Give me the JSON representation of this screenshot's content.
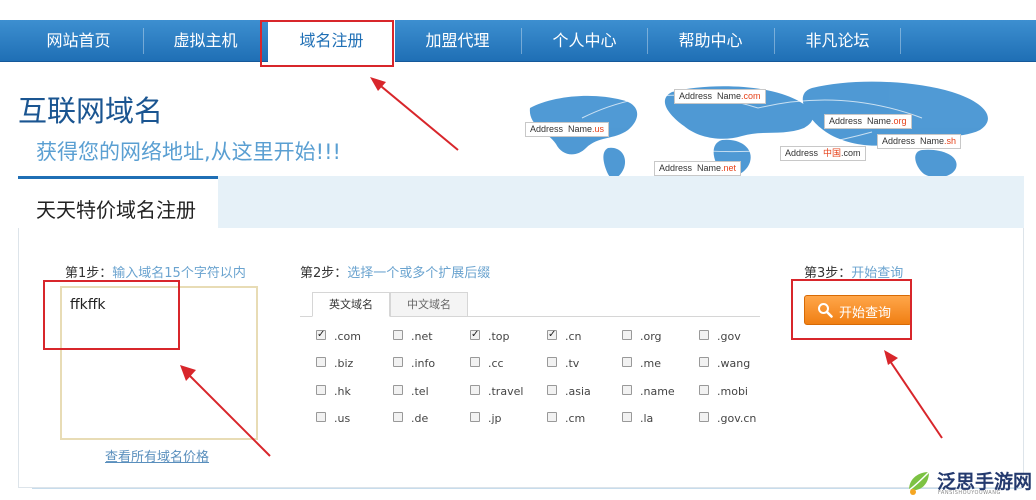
{
  "nav": {
    "items": [
      {
        "label": "网站首页"
      },
      {
        "label": "虚拟主机"
      },
      {
        "label": "域名注册",
        "active": true
      },
      {
        "label": "加盟代理"
      },
      {
        "label": "个人中心"
      },
      {
        "label": "帮助中心"
      },
      {
        "label": "非凡论坛"
      }
    ]
  },
  "header": {
    "title": "互联网域名",
    "subtitle": "获得您的网络地址,从这里开始!!!"
  },
  "map": {
    "tags": [
      {
        "word": "Address",
        "name": "Name",
        "tld": ".com"
      },
      {
        "word": "Address",
        "name": "Name",
        "tld": ".us"
      },
      {
        "word": "Address",
        "name": "Name",
        "tld": ".org"
      },
      {
        "word": "Address",
        "name": "Name",
        "tld": ".sh"
      },
      {
        "word": "Address",
        "cn": "中国",
        "tld": ".com"
      },
      {
        "word": "Address",
        "name": "Name",
        "tld": ".net"
      }
    ]
  },
  "panel": {
    "tab": "天天特价域名注册"
  },
  "step1": {
    "label": "第1步：",
    "hint": "输入域名15个字符以内",
    "value": "ffkffk",
    "price_link": "查看所有域名价格"
  },
  "step2": {
    "label": "第2步：",
    "hint": "选择一个或多个扩展后缀",
    "tabs": [
      "英文域名",
      "中文域名"
    ],
    "options": [
      {
        "label": ".com",
        "checked": true
      },
      {
        "label": ".net",
        "checked": false
      },
      {
        "label": ".top",
        "checked": true
      },
      {
        "label": ".cn",
        "checked": true
      },
      {
        "label": ".org",
        "checked": false
      },
      {
        "label": ".gov",
        "checked": false
      },
      {
        "label": ".biz",
        "checked": false
      },
      {
        "label": ".info",
        "checked": false
      },
      {
        "label": ".cc",
        "checked": false
      },
      {
        "label": ".tv",
        "checked": false
      },
      {
        "label": ".me",
        "checked": false
      },
      {
        "label": ".wang",
        "checked": false
      },
      {
        "label": ".hk",
        "checked": false
      },
      {
        "label": ".tel",
        "checked": false
      },
      {
        "label": ".travel",
        "checked": false
      },
      {
        "label": ".asia",
        "checked": false
      },
      {
        "label": ".name",
        "checked": false
      },
      {
        "label": ".mobi",
        "checked": false
      },
      {
        "label": ".us",
        "checked": false
      },
      {
        "label": ".de",
        "checked": false
      },
      {
        "label": ".jp",
        "checked": false
      },
      {
        "label": ".cm",
        "checked": false
      },
      {
        "label": ".la",
        "checked": false
      },
      {
        "label": ".gov.cn",
        "checked": false
      }
    ]
  },
  "step3": {
    "label": "第3步：",
    "hint": "开始查询",
    "button": "开始查询"
  },
  "watermark": {
    "title": "泛思手游网",
    "sub": "FANSISHOUYOUWANG"
  },
  "colors": {
    "nav": "#1f6fb5",
    "accent_orange": "#f07f13",
    "highlight_red": "#d8262b"
  }
}
